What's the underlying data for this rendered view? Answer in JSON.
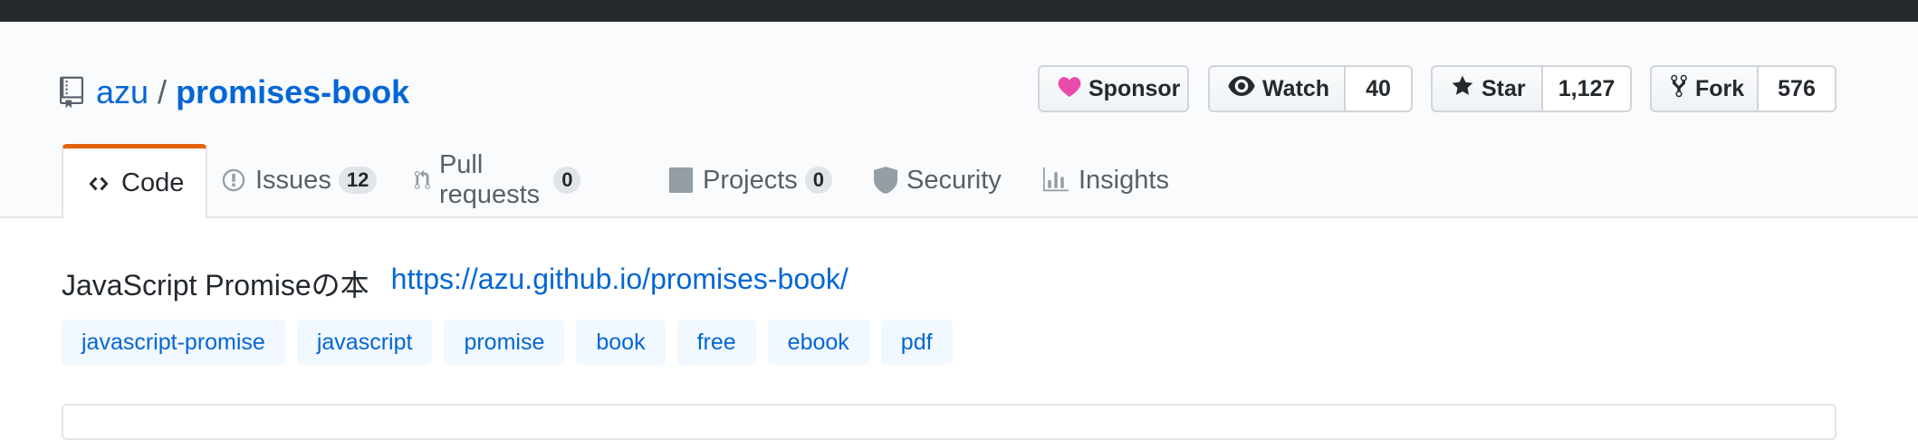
{
  "repo": {
    "owner": "azu",
    "separator": "/",
    "name": "promises-book"
  },
  "actions": {
    "sponsor_label": "Sponsor",
    "watch_label": "Watch",
    "watch_count": "40",
    "star_label": "Star",
    "star_count": "1,127",
    "fork_label": "Fork",
    "fork_count": "576"
  },
  "tabs": [
    {
      "label": "Code",
      "icon": "code-icon",
      "active": true
    },
    {
      "label": "Issues",
      "icon": "issue-icon",
      "count": "12"
    },
    {
      "label": "Pull requests",
      "icon": "pull-request-icon",
      "count": "0"
    },
    {
      "label": "Projects",
      "icon": "project-icon",
      "count": "0"
    },
    {
      "label": "Security",
      "icon": "shield-icon"
    },
    {
      "label": "Insights",
      "icon": "graph-icon"
    }
  ],
  "about": {
    "description": "JavaScript Promiseの本",
    "homepage": "https://azu.github.io/promises-book/"
  },
  "topics": [
    "javascript-promise",
    "javascript",
    "promise",
    "book",
    "free",
    "ebook",
    "pdf"
  ],
  "colors": {
    "link": "#0366d6",
    "active_tab_accent": "#e36209",
    "sponsor_heart": "#ea4aaa",
    "topbar": "#24292e"
  }
}
